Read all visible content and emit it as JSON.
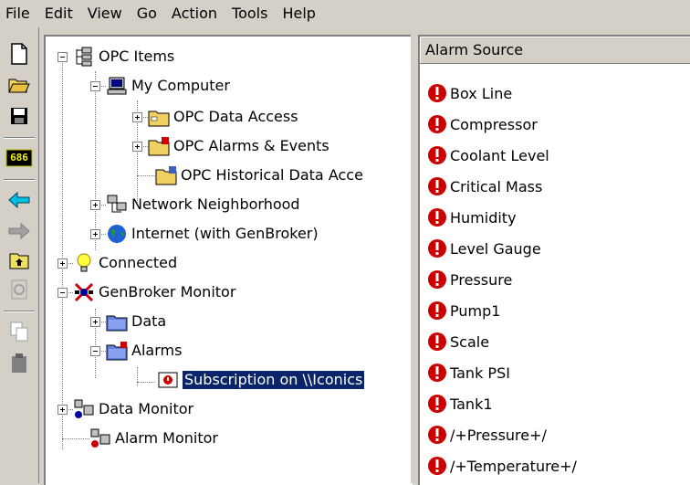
{
  "menu": [
    "File",
    "Edit",
    "View",
    "Go",
    "Action",
    "Tools",
    "Help"
  ],
  "toolbar": {
    "buttons": [
      {
        "name": "new-icon"
      },
      {
        "name": "open-folder-icon"
      },
      {
        "name": "save-icon"
      },
      {
        "name": "counter-686-icon",
        "text": "686"
      },
      {
        "name": "back-arrow-icon"
      },
      {
        "name": "forward-arrow-icon"
      },
      {
        "name": "up-folder-icon"
      },
      {
        "name": "refresh-icon"
      },
      {
        "name": "copy-icon"
      },
      {
        "name": "paste-icon"
      }
    ]
  },
  "tree": {
    "opc_items": "OPC Items",
    "my_computer": "My Computer",
    "opc_data_access": "OPC Data Access",
    "opc_alarms_events": "OPC Alarms & Events",
    "opc_historical": "OPC Historical Data Acce",
    "network_neighborhood": "Network Neighborhood",
    "internet": "Internet (with GenBroker)",
    "connected": "Connected",
    "genbroker_monitor": "GenBroker Monitor",
    "data": "Data",
    "alarms": "Alarms",
    "subscription": "Subscription on \\\\Iconics",
    "data_monitor": "Data Monitor",
    "alarm_monitor": "Alarm Monitor"
  },
  "list": {
    "header": "Alarm Source",
    "items": [
      "Box Line",
      "Compressor",
      "Coolant Level",
      "Critical Mass",
      "Humidity",
      "Level Gauge",
      "Pressure",
      "Pump1",
      "Scale",
      "Tank PSI",
      "Tank1",
      "/+Pressure+/",
      "/+Temperature+/"
    ],
    "alarm_color": "#cc0000"
  },
  "colors": {
    "selection": "#0a246a",
    "chrome": "#d4d0c8"
  }
}
